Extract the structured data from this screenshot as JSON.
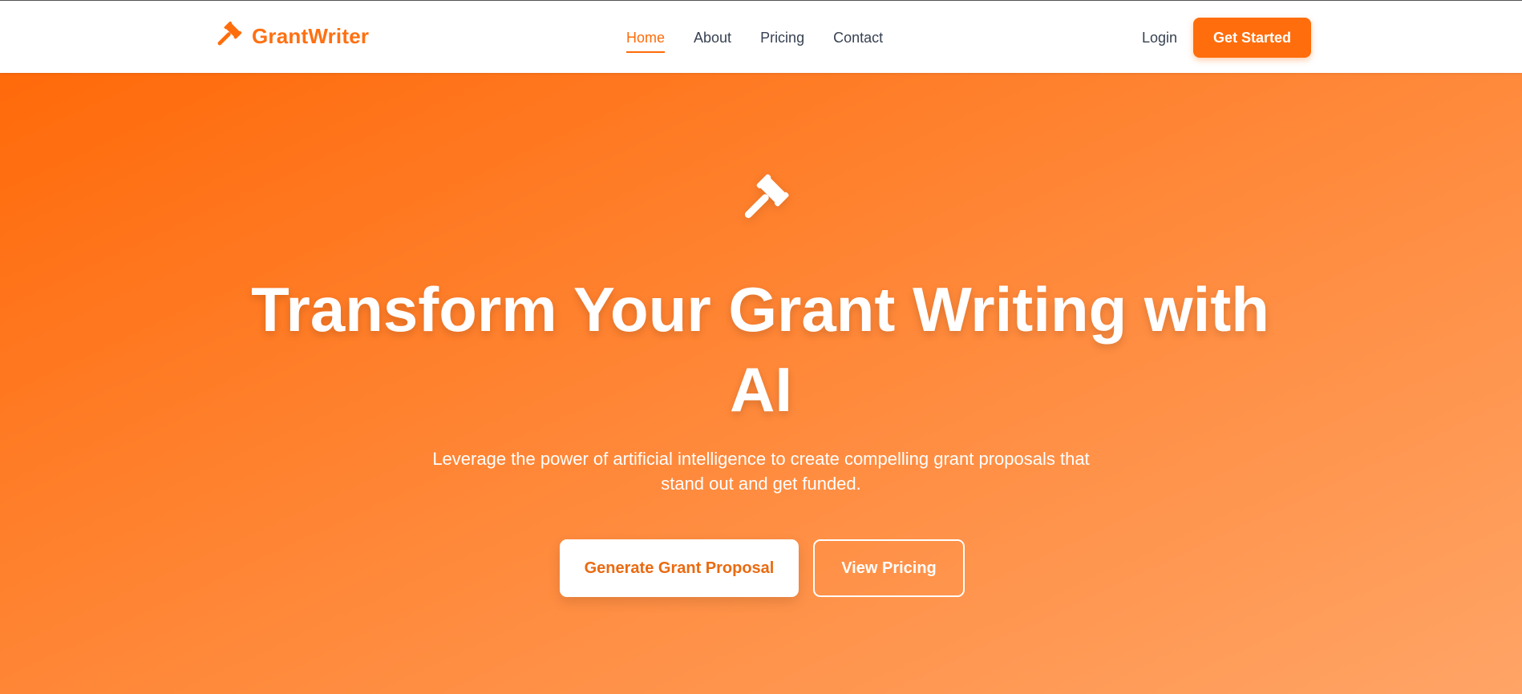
{
  "brand": {
    "name": "GrantWriter",
    "icon": "gavel-icon"
  },
  "nav": {
    "links": [
      "Home",
      "About",
      "Pricing",
      "Contact"
    ],
    "active": "Home",
    "login": "Login",
    "cta": "Get Started"
  },
  "hero": {
    "icon": "gavel-icon",
    "title_line1": "Transform Your Grant Writing with",
    "title_line2": "AI",
    "subtitle_line1": "Leverage the power of artificial intelligence to create compelling grant proposals that",
    "subtitle_line2": "stand out and get funded.",
    "primary_button": "Generate Grant Proposal",
    "secondary_button": "View Pricing"
  },
  "colors": {
    "accent": "#ff6d0c",
    "hero_gradient_start": "#ff6a0a",
    "hero_gradient_end": "#ffa466",
    "text_dark": "#374151"
  }
}
